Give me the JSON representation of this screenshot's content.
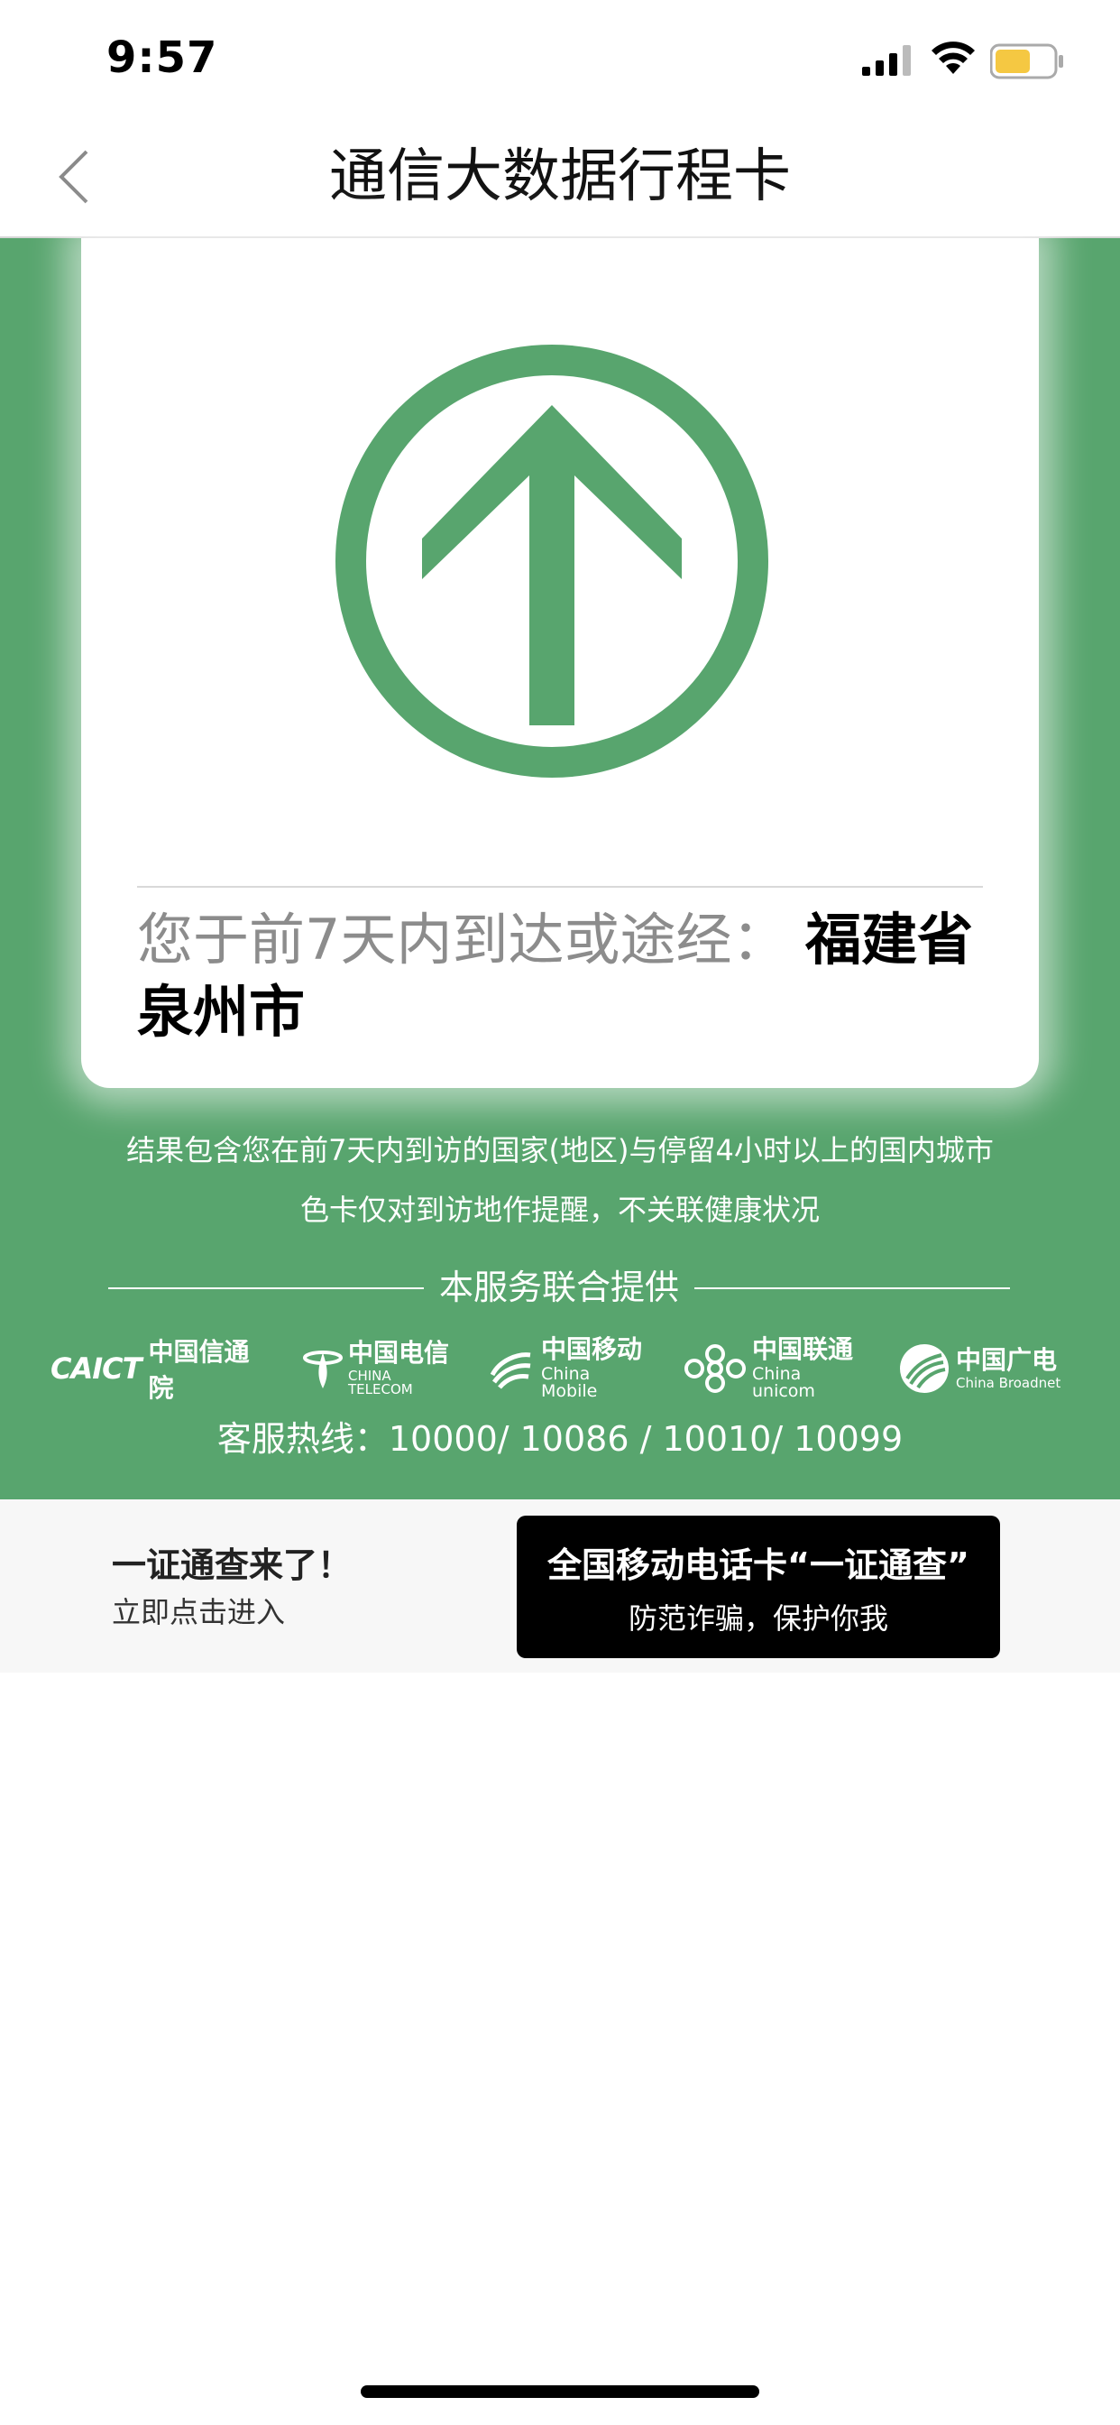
{
  "status_bar": {
    "time": "9:57"
  },
  "nav": {
    "title": "通信大数据行程卡"
  },
  "card": {
    "arrow_color": "#58a56e",
    "location_prefix": "您于前7天内到达或途经：",
    "location": "福建省泉州市"
  },
  "notes": {
    "line1": "结果包含您在前7天内到访的国家(地区)与停留4小时以上的国内城市",
    "line2": "色卡仅对到访地作提醒，不关联健康状况"
  },
  "service": {
    "title": "本服务联合提供",
    "partners": [
      {
        "name": "CAICT",
        "cn": "中国信通院",
        "icon": "caict-logo"
      },
      {
        "cn": "中国电信",
        "en": "CHINA TELECOM",
        "icon": "china-telecom-icon"
      },
      {
        "cn": "中国移动",
        "en": "China Mobile",
        "icon": "china-mobile-icon"
      },
      {
        "cn": "中国联通",
        "en": "China unicom",
        "icon": "china-unicom-icon"
      },
      {
        "cn": "中国广电",
        "en": "China Broadnet",
        "icon": "china-broadnet-icon"
      }
    ],
    "hotline": "客服热线：10000/ 10086 / 10010/ 10099"
  },
  "promo": {
    "title": "一证通查来了！",
    "subtitle": "立即点击进入",
    "button_title": "全国移动电话卡“一证通查”",
    "button_subtitle": "防范诈骗，保护你我"
  },
  "colors": {
    "green": "#58a56e",
    "battery": "#f5c842"
  }
}
